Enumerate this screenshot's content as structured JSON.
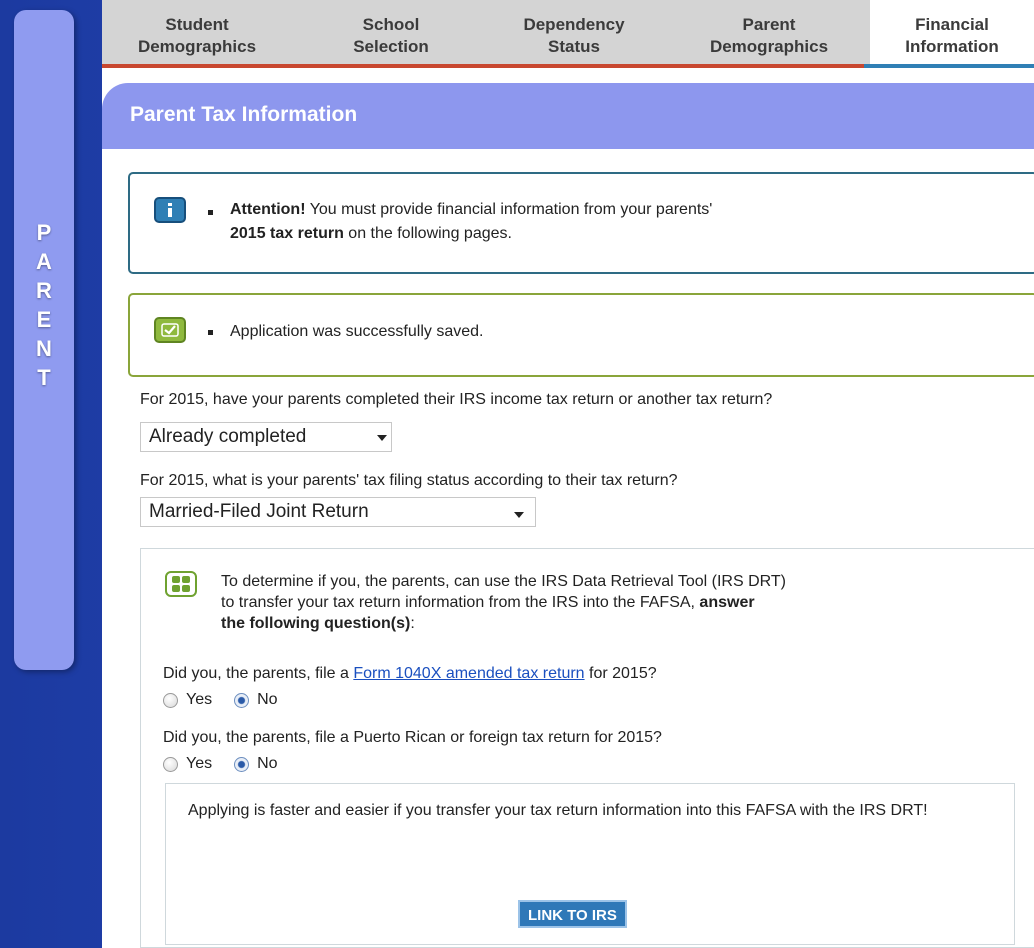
{
  "sidebar": {
    "letters": [
      "P",
      "A",
      "R",
      "E",
      "N",
      "T"
    ]
  },
  "tabs": [
    {
      "line1": "Student",
      "line2": "Demographics"
    },
    {
      "line1": "School",
      "line2": "Selection"
    },
    {
      "line1": "Dependency",
      "line2": "Status"
    },
    {
      "line1": "Parent",
      "line2": "Demographics"
    },
    {
      "line1": "Financial",
      "line2": "Information"
    }
  ],
  "colors": {
    "tab_line_completed": "#c8472f",
    "tab_line_active": "#2f7fb5",
    "header": "#8d97ee"
  },
  "section": {
    "title": "Parent Tax Information"
  },
  "info_alert": {
    "icon": "info-icon",
    "strong_prefix": "Attention!",
    "text_part1": " You must provide financial information from your parents'",
    "strong_year": "2015 tax return",
    "text_part2": " on the following pages."
  },
  "success_alert": {
    "icon": "checkmark-icon",
    "text": "Application was successfully saved."
  },
  "q1": {
    "label": "For 2015, have your parents completed their IRS income tax return or another tax return?",
    "selected": "Already completed"
  },
  "q2": {
    "label": "For 2015, what is your parents' tax filing status according to their tax return?",
    "selected": "Married-Filed Joint Return"
  },
  "drt": {
    "icon": "grid-icon",
    "text_line1": "To determine if you, the parents, can use the IRS Data Retrieval Tool (IRS DRT)",
    "text_line2_plain": "to transfer your tax return information from the IRS into the FAFSA, ",
    "text_line2_strong": "answer",
    "text_line3_strong": "the following question(s)",
    "text_line3_end": ":",
    "amended": {
      "prefix": "Did you, the parents, file a ",
      "link": "Form 1040X amended tax return",
      "suffix": " for 2015?",
      "yes": "Yes",
      "no": "No",
      "selected": "No"
    },
    "foreign": {
      "question": "Did you, the parents, file a Puerto Rican or foreign tax return for 2015?",
      "yes": "Yes",
      "no": "No",
      "selected": "No"
    },
    "transfer_text": "Applying is faster and easier if you transfer your tax return information into this FAFSA with the IRS DRT!",
    "button_label": "LINK TO IRS"
  }
}
